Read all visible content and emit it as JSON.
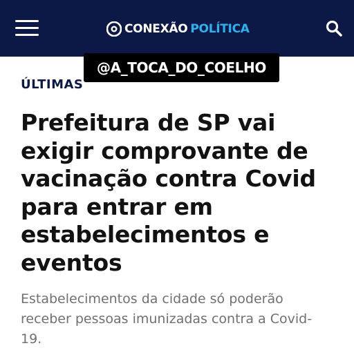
{
  "header": {
    "brand_part1": "CONEXÃO",
    "brand_part2": "POLÍTICA",
    "menu_icon": "hamburger-menu-icon",
    "search_icon": "search-icon",
    "logo_icon": "conexao-politica-logo-icon"
  },
  "watermark": {
    "text": "@A_TOCA_DO_COELHO"
  },
  "article": {
    "category": "ÚLTIMAS",
    "title": "Prefeitura de SP vai exigir comprovante de vacinação contra Covid para entrar em estabelecimentos e eventos",
    "subtitle": "Estabelecimentos da cidade só poderão receber pessoas imunizadas contra a Covid-19."
  },
  "colors": {
    "header_bg": "#0c1846",
    "brand_accent": "#2bb3f0",
    "title_text": "#121212",
    "subtitle_text": "#707070"
  }
}
